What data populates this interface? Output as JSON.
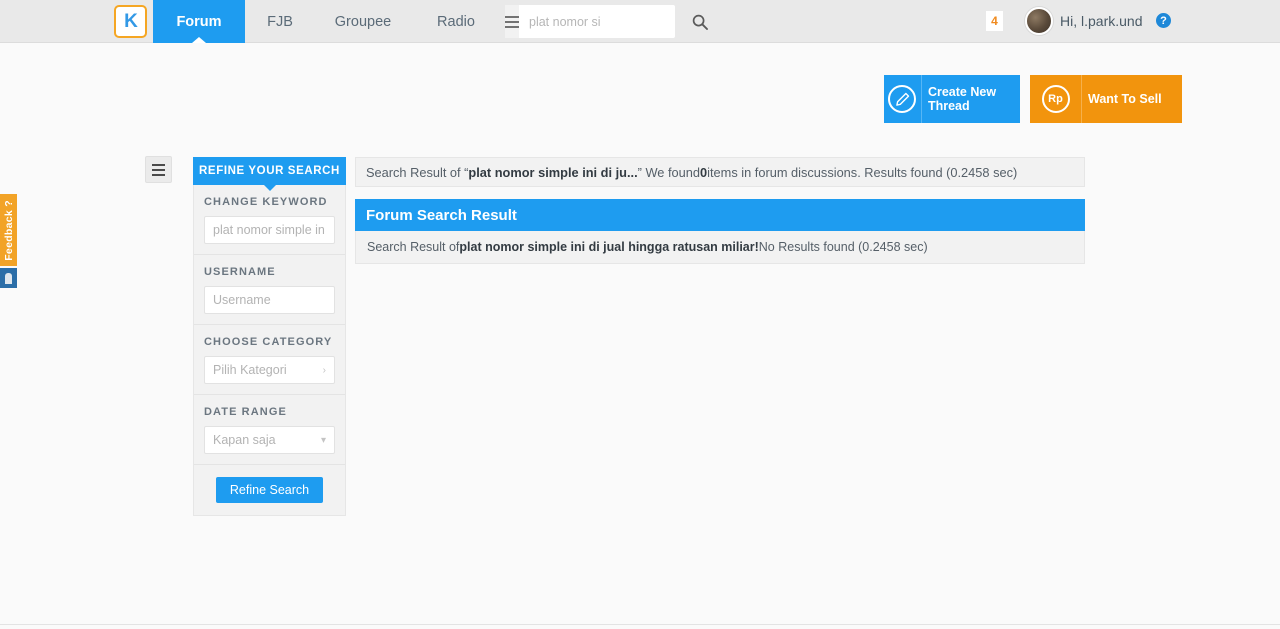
{
  "header": {
    "logo_text": "K",
    "logo_name": "kaskus-logo",
    "nav": [
      {
        "label": "Forum",
        "active": true
      },
      {
        "label": "FJB",
        "active": false
      },
      {
        "label": "Groupee",
        "active": false
      },
      {
        "label": "Radio",
        "active": false
      }
    ],
    "search": {
      "value": "",
      "placeholder": "plat nomor si",
      "menu_icon": "hamburger-icon",
      "submit_icon": "search-icon"
    },
    "notification_count": "4",
    "greeting": "Hi, l.park.und",
    "help_icon_glyph": "?"
  },
  "actions": {
    "create_thread": {
      "label": "Create New Thread",
      "icon": "pencil-icon",
      "color": "#1e9cf0"
    },
    "want_to_sell": {
      "label": "Want To Sell",
      "icon": "rupiah-icon",
      "icon_text": "Rp",
      "color": "#f2940d"
    }
  },
  "sidebar": {
    "toggle_icon": "hamburger-icon",
    "title": "REFINE YOUR SEARCH",
    "fields": [
      {
        "label": "CHANGE KEYWORD",
        "type": "input",
        "value": "",
        "placeholder": "plat nomor simple in"
      },
      {
        "label": "USERNAME",
        "type": "input",
        "value": "",
        "placeholder": "Username"
      },
      {
        "label": "CHOOSE CATEGORY",
        "type": "select",
        "value": "Pilih Kategori",
        "arrow": "›"
      },
      {
        "label": "DATE RANGE",
        "type": "select",
        "value": "Kapan saja",
        "arrow": "▾"
      }
    ],
    "submit_label": "Refine Search"
  },
  "summary": {
    "prefix": "Search Result of “",
    "query_truncated": "plat nomor simple ini di ju...",
    "middle": "” We found ",
    "count": "0",
    "suffix": " items in forum discussions. Results found (0.2458 sec)"
  },
  "result_panel": {
    "title": "Forum Search Result",
    "prefix": "Search Result of ",
    "query": "plat nomor simple ini di jual hingga ratusan miliar!",
    "suffix": " No Results found (0.2458 sec)"
  },
  "feedback": {
    "label": "Feedback ?",
    "icon": "person-icon"
  },
  "colors": {
    "brand_blue": "#1e9cf0",
    "brand_orange": "#f2940d",
    "feedback_orange": "#f2a327",
    "header_bg": "#e9e9e9",
    "panel_bg": "#f2f2f2"
  }
}
